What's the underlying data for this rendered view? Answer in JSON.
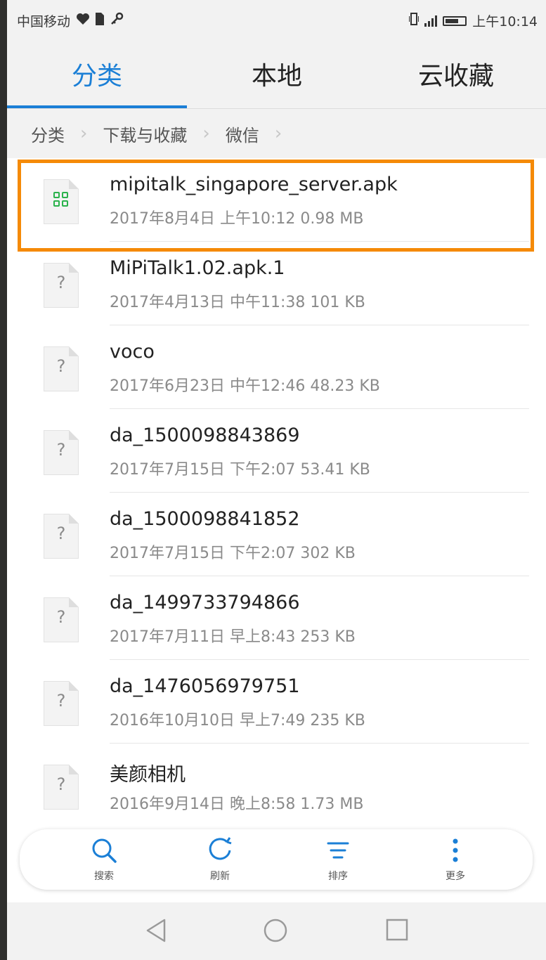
{
  "status_bar": {
    "carrier": "中国移动",
    "time": "上午10:14"
  },
  "tabs": [
    {
      "label": "分类",
      "active": true
    },
    {
      "label": "本地",
      "active": false
    },
    {
      "label": "云收藏",
      "active": false
    }
  ],
  "breadcrumb": [
    "分类",
    "下载与收藏",
    "微信"
  ],
  "files": [
    {
      "name": "mipitalk_singapore_server.apk",
      "meta": "2017年8月4日 上午10:12 0.98 MB",
      "icon": "apk-file-icon"
    },
    {
      "name": "MiPiTalk1.02.apk.1",
      "meta": "2017年4月13日 中午11:38 101 KB",
      "icon": "unknown-file-icon"
    },
    {
      "name": "voco",
      "meta": "2017年6月23日 中午12:46 48.23 KB",
      "icon": "unknown-file-icon"
    },
    {
      "name": "da_1500098843869",
      "meta": "2017年7月15日 下午2:07 53.41 KB",
      "icon": "unknown-file-icon"
    },
    {
      "name": "da_1500098841852",
      "meta": "2017年7月15日 下午2:07 302 KB",
      "icon": "unknown-file-icon"
    },
    {
      "name": "da_1499733794866",
      "meta": "2017年7月11日 早上8:43 253 KB",
      "icon": "unknown-file-icon"
    },
    {
      "name": "da_1476056979751",
      "meta": "2016年10月10日 早上7:49 235 KB",
      "icon": "unknown-file-icon"
    },
    {
      "name": "美颜相机",
      "meta": "2016年9月14日 晚上8:58 1.73 MB",
      "icon": "unknown-file-icon"
    }
  ],
  "toolbar": [
    {
      "label": "搜索",
      "icon": "search-icon"
    },
    {
      "label": "刷新",
      "icon": "refresh-icon"
    },
    {
      "label": "排序",
      "icon": "sort-icon"
    },
    {
      "label": "更多",
      "icon": "more-icon"
    }
  ],
  "colors": {
    "accent": "#1b7fd6",
    "highlight": "#f58a07",
    "apk_green": "#2bb24c"
  }
}
